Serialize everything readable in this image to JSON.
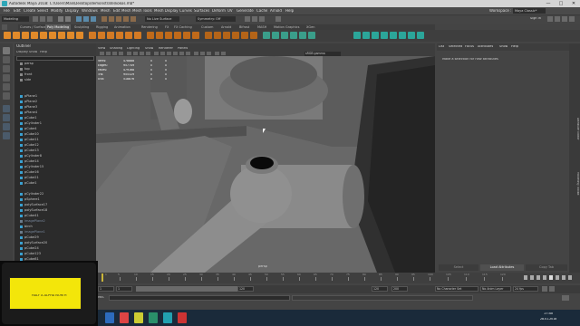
{
  "window": {
    "title": "Autodesk Maya 2018: C:\\Users\\Mali\\Desktop\\demonstrate\\kokos.mb*",
    "buttons": [
      "—",
      "□",
      "✕"
    ]
  },
  "menubar": {
    "items": [
      "File",
      "Edit",
      "Create",
      "Select",
      "Modify",
      "Display",
      "Windows",
      "Mesh",
      "Edit Mesh",
      "Mesh Tools",
      "Mesh Display",
      "Curves",
      "Surfaces",
      "Deform",
      "UV",
      "Generate",
      "Cache",
      "Arnold",
      "Help"
    ],
    "workspace_label": "Workspace :",
    "workspace_value": "Maya Classic*"
  },
  "statusline": {
    "mode": "Modeling",
    "live_surface": "No Live Surface",
    "symmetry": "Symmetry: Off",
    "sign_in": "Sign In"
  },
  "shelf": {
    "tabs": [
      "Curves / Surfaces",
      "Poly Modeling",
      "Sculpting",
      "Rigging",
      "Animation",
      "Rendering",
      "FX",
      "FX Caching",
      "Custom",
      "Arnold",
      "Bifrost",
      "MASH",
      "Motion Graphics",
      "XGen"
    ],
    "active_tab": "Poly Modeling"
  },
  "outliner": {
    "title": "Outliner",
    "menu": [
      "Display",
      "Show",
      "Help"
    ],
    "search_placeholder": "",
    "items": [
      "persp",
      "top",
      "front",
      "side",
      "pPlane1",
      "pPlane2",
      "pPlane3",
      "pPlane4",
      "pCube1",
      "pCylinder1",
      "pCube4",
      "pCube10",
      "pCube11",
      "pCube12",
      "pCube13",
      "pCylinder8",
      "pCube14",
      "pCylinder15",
      "pCube16",
      "pCube21",
      "pCube1",
      "pCylinder22",
      "pSphere1",
      "polySurface17",
      "polySurface18",
      "pCube41",
      "imagePlane2",
      "birch",
      "imagePlane1",
      "pCube29",
      "polySurface20",
      "pCube24",
      "pCube123",
      "pCube81"
    ]
  },
  "viewport": {
    "menu": [
      "View",
      "Shading",
      "Lighting",
      "Show",
      "Renderer",
      "Panels"
    ],
    "camera": "persp",
    "color_space": "sRGB gamma",
    "hud": [
      {
        "label": "Verts:",
        "a": "478888",
        "b": "0",
        "c": "0"
      },
      {
        "label": "Edges:",
        "a": "957749",
        "b": "0",
        "c": "0"
      },
      {
        "label": "Faces:",
        "a": "479168",
        "b": "0",
        "c": "0"
      },
      {
        "label": "Tris:",
        "a": "955329",
        "b": "0",
        "c": "0"
      },
      {
        "label": "UVs:",
        "a": "518876",
        "b": "0",
        "c": "0"
      }
    ]
  },
  "attribute_editor": {
    "menu": [
      "List",
      "Selected",
      "Focus",
      "Attributes",
      "Show",
      "Help"
    ],
    "message": "Make a selection for new attributes",
    "buttons": [
      "Select",
      "Load Attributes",
      "Copy Tab"
    ],
    "side_tabs": [
      "Attribute Editor",
      "Modeling Toolkit"
    ]
  },
  "timeline": {
    "ticks": [
      "5",
      "10",
      "15",
      "20",
      "25",
      "30",
      "35",
      "40",
      "45",
      "50",
      "55",
      "60",
      "65",
      "70",
      "75",
      "80",
      "85",
      "90",
      "95",
      "100",
      "105",
      "110",
      "115",
      "120"
    ],
    "current_frame": "1"
  },
  "range": {
    "start": "1",
    "anim_start": "1",
    "range_end": "120",
    "anim_end": "120",
    "end": "200",
    "character_set": "No Character Set",
    "anim_layer": "No Anim Layer",
    "fps": "24 fps"
  },
  "commandline": {
    "label": "MEL"
  },
  "taskbar": {
    "time": "17:40",
    "date": "28.01.2018"
  },
  "overlay": {
    "sticker_text": "HALF A ALPHA NORTH"
  }
}
